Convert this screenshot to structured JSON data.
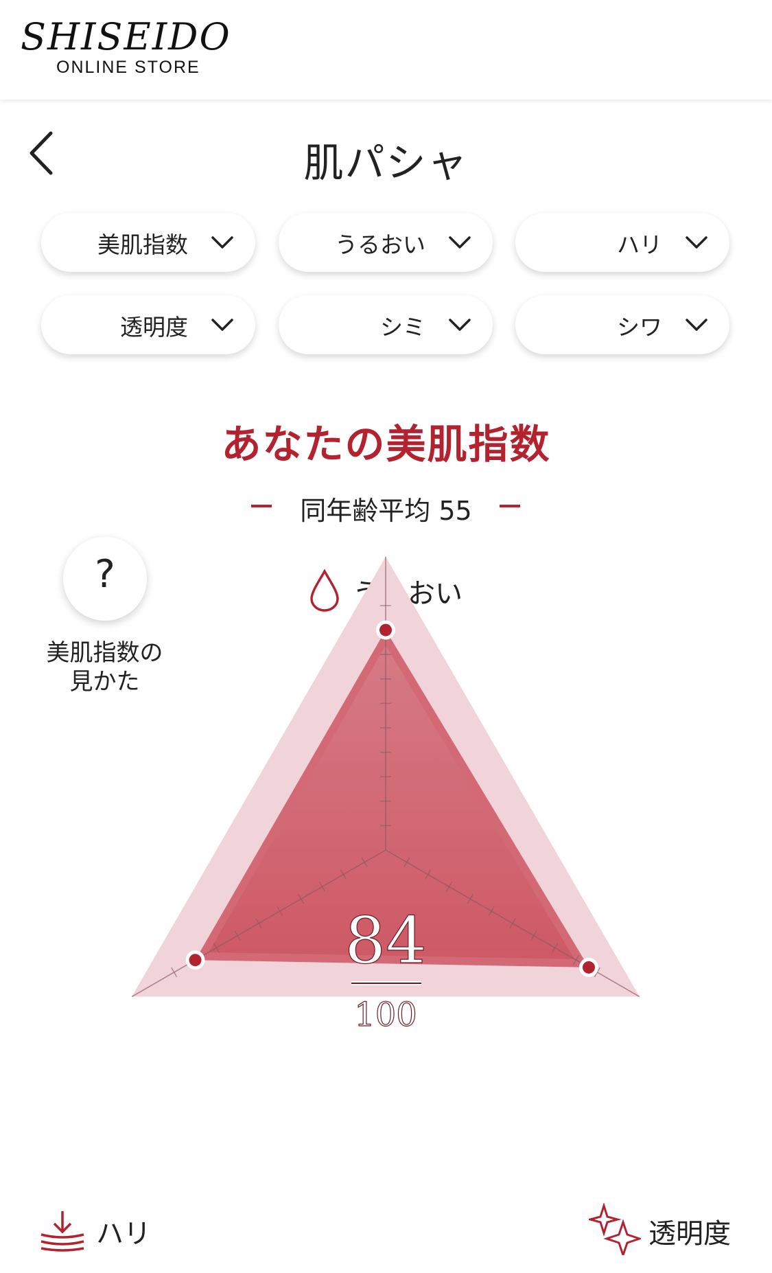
{
  "header": {
    "brand": "SHISEIDO",
    "brand_sub": "ONLINE STORE"
  },
  "nav": {
    "title": "肌パシャ",
    "back_icon": "chevron-left-icon"
  },
  "filters": [
    {
      "label": "美肌指数"
    },
    {
      "label": "うるおい"
    },
    {
      "label": "ハリ"
    },
    {
      "label": "透明度"
    },
    {
      "label": "シミ"
    },
    {
      "label": "シワ"
    }
  ],
  "result": {
    "title": "あなたの美肌指数",
    "average_label": "同年齢平均 55",
    "help_symbol": "?",
    "help_label_line1": "美肌指数の",
    "help_label_line2": "見かた",
    "score": "84",
    "max": "100"
  },
  "axes": {
    "top": "うるおい",
    "left": "ハリ",
    "right": "透明度"
  },
  "colors": {
    "accent": "#b3232f",
    "outer_fill": "#f1d4da",
    "avg_fill": "#d7747f",
    "user_fill": "#cf606c"
  },
  "chart_data": {
    "type": "radar",
    "axes": [
      "うるおい",
      "ハリ",
      "透明度"
    ],
    "scale_max": 100,
    "series": [
      {
        "values": [
          90,
          90,
          96
        ]
      },
      {
        "values": [
          55,
          55,
          55
        ]
      }
    ]
  }
}
